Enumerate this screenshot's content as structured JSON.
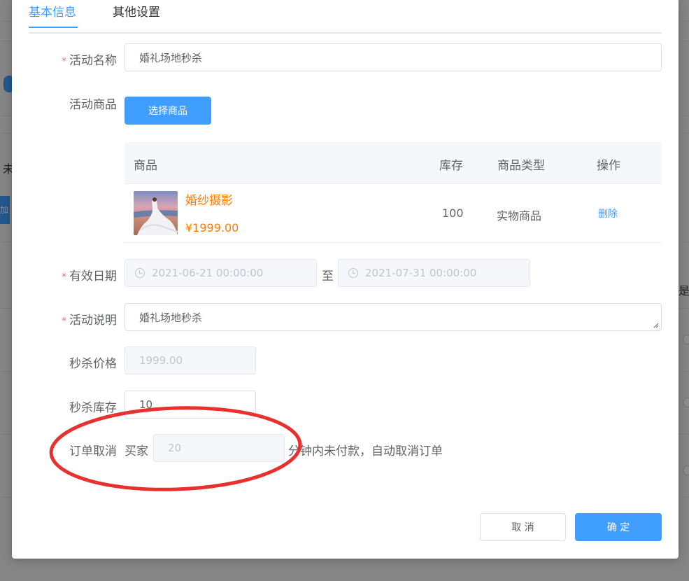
{
  "background": {
    "left_text": "未",
    "left_text_2": "加",
    "right_text": "是"
  },
  "tabs": [
    {
      "label": "基本信息",
      "active": true
    },
    {
      "label": "其他设置",
      "active": false
    }
  ],
  "form": {
    "activity_name": {
      "label": "活动名称",
      "required": true,
      "value": "婚礼场地秒杀"
    },
    "activity_goods": {
      "label": "活动商品",
      "button": "选择商品"
    },
    "valid_date": {
      "label": "有效日期",
      "required": true,
      "start": "2021-06-21 00:00:00",
      "separator": "至",
      "end": "2021-07-31 00:00:00"
    },
    "description": {
      "label": "活动说明",
      "required": true,
      "value": "婚礼场地秒杀"
    },
    "seckill_price": {
      "label": "秒杀价格",
      "value": "1999.00"
    },
    "seckill_stock": {
      "label": "秒杀库存",
      "value": "10"
    },
    "order_cancel": {
      "label": "订单取消",
      "prefix": "买家",
      "value": "20",
      "suffix": "分钟内未付款，自动取消订单"
    }
  },
  "goods_table": {
    "headers": [
      "商品",
      "库存",
      "商品类型",
      "操作"
    ],
    "rows": [
      {
        "name": "婚纱摄影",
        "price": "¥1999.00",
        "stock": "100",
        "type": "实物商品",
        "action": "删除"
      }
    ]
  },
  "footer": {
    "cancel_label": "取 消",
    "confirm_label": "确 定"
  },
  "colors": {
    "primary": "#409eff",
    "price": "#ff7a00",
    "required": "#f56c6c",
    "annotation": "#e8312f"
  },
  "icons": {
    "date_icon": "clock-icon",
    "resize": "resize-grip-icon"
  }
}
